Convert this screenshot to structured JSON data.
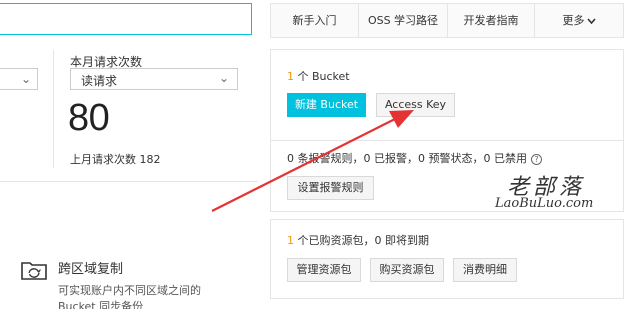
{
  "left": {
    "stat_title": "本月请求次数",
    "select_value": "读请求",
    "request_count": "80",
    "last_month_label": "上月请求次数",
    "last_month_value": "182",
    "cross_region": {
      "title": "跨区域复制",
      "desc_line1": "可实现账户内不同区域之间的",
      "desc_line2": "Bucket 同步备份"
    }
  },
  "nav": {
    "items": [
      "新手入门",
      "OSS 学习路径",
      "开发者指南"
    ],
    "more": "更多"
  },
  "bucket_card": {
    "count": "1",
    "label": "个 Bucket",
    "create_button": "新建 Bucket",
    "access_key_button": "Access Key"
  },
  "alarm_card": {
    "summary": "0 条报警规则，0 已报警，0 预警状态，0 已禁用",
    "settings_button": "设置报警规则"
  },
  "resource_card": {
    "count": "1",
    "summary": "个已购资源包，0 即将到期",
    "buttons": [
      "管理资源包",
      "购买资源包",
      "消费明细"
    ]
  },
  "watermark": {
    "cn": "老部落",
    "en": "LaoBuLuo.com"
  },
  "colors": {
    "accent": "#00c1de",
    "orange": "#f39800",
    "arrow": "#e53333"
  }
}
